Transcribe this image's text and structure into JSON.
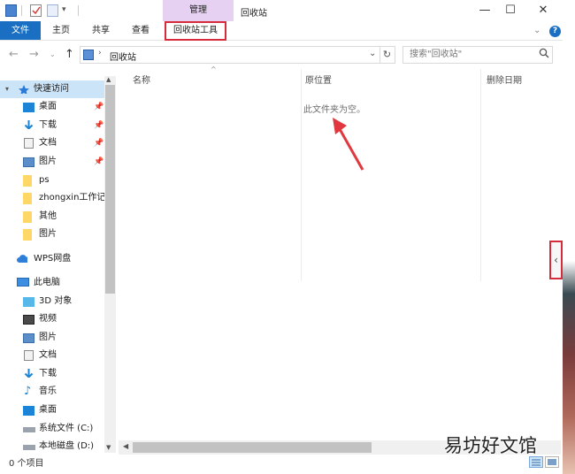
{
  "window": {
    "title": "回收站",
    "context_tab": "管理",
    "controls": {
      "minimize": "—",
      "maximize": "☐",
      "close": "✕"
    }
  },
  "ribbon": {
    "tabs": [
      "文件",
      "主页",
      "共享",
      "查看"
    ],
    "tools_tab": "回收站工具",
    "help": "?"
  },
  "address": {
    "path": "回收站",
    "search_placeholder": "搜索\"回收站\""
  },
  "nav_pane": {
    "quick_access": "快速访问",
    "quick_items": [
      "桌面",
      "下载",
      "文档",
      "图片",
      "ps",
      "zhongxin工作记",
      "其他",
      "图片"
    ],
    "wps": "WPS网盘",
    "this_pc": "此电脑",
    "pc_items": [
      "3D 对象",
      "视频",
      "图片",
      "文档",
      "下载",
      "音乐",
      "桌面",
      "系统文件 (C:)",
      "本地磁盘 (D:)"
    ]
  },
  "columns": {
    "name": "名称",
    "original_location": "原位置",
    "date_deleted": "删除日期"
  },
  "content": {
    "empty_message": "此文件夹为空。"
  },
  "status": {
    "item_count": "0 个项目"
  },
  "watermark": "易坊好文馆",
  "icons": [
    "back-arrow-icon",
    "forward-arrow-icon",
    "up-arrow-icon",
    "recycle-bin-icon",
    "refresh-icon",
    "search-icon",
    "pin-icon",
    "folder-icon",
    "drive-icon",
    "music-icon",
    "cloud-icon",
    "pc-icon"
  ],
  "colors": {
    "accent": "#1b6fc2",
    "context_tab": "#e6d1f3",
    "highlight": "#d62b3a",
    "arrow": "#e0383e",
    "folder": "#ffd766"
  }
}
